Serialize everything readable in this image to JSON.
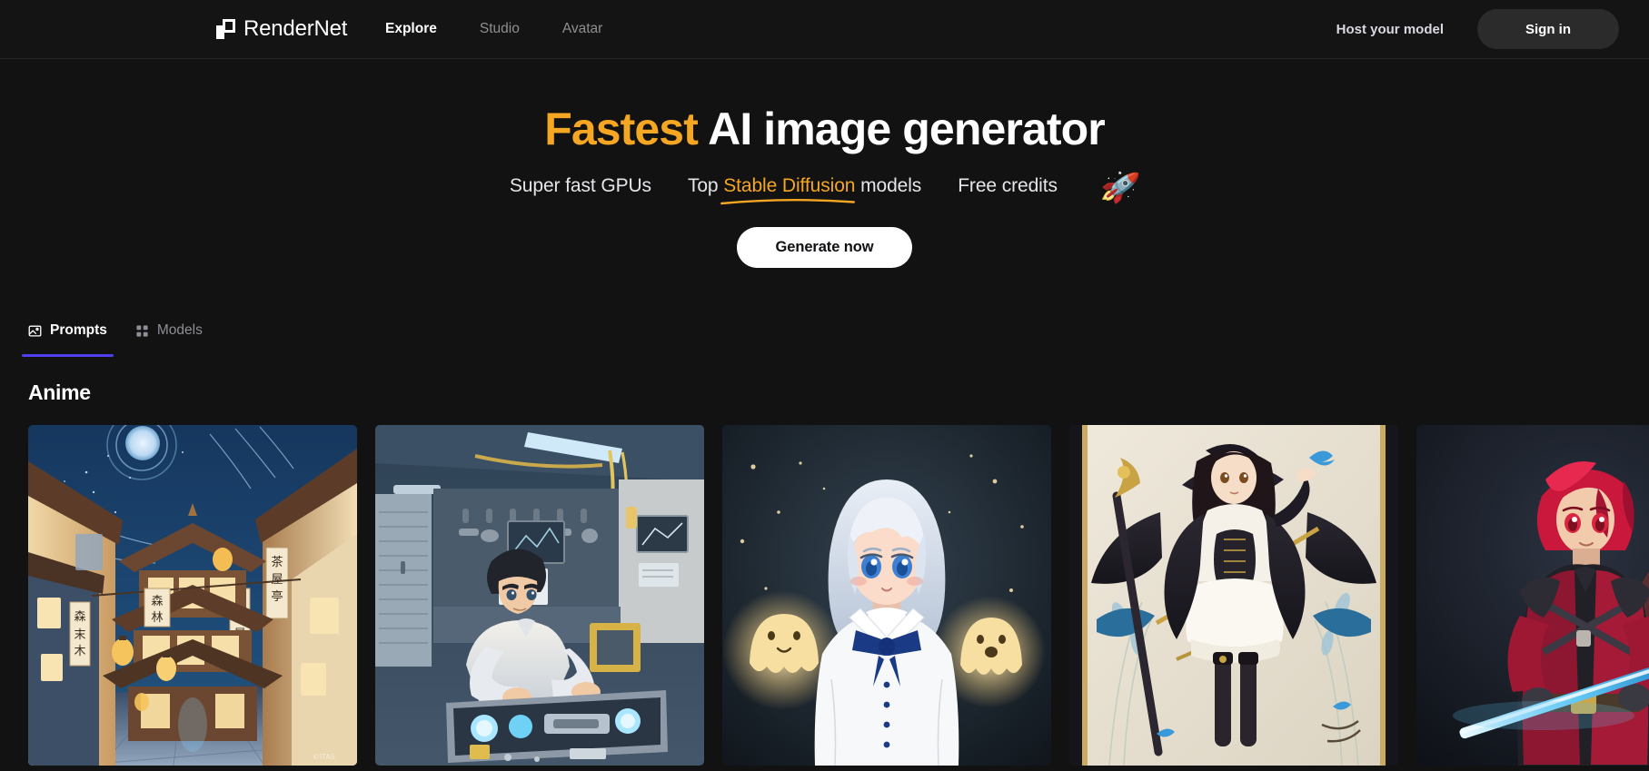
{
  "header": {
    "brand": "RenderNet",
    "brand_icon": "rendernet-logo-icon",
    "nav": [
      {
        "label": "Explore",
        "active": true
      },
      {
        "label": "Studio",
        "active": false
      },
      {
        "label": "Avatar",
        "active": false
      }
    ],
    "host_link": "Host your model",
    "signin_label": "Sign in"
  },
  "hero": {
    "title_accent": "Fastest",
    "title_rest": " AI image generator",
    "sub_1": "Super fast GPUs",
    "sub_2_pre": "Top ",
    "sub_2_accent": "Stable Diffusion",
    "sub_2_post": " models",
    "sub_3": "Free credits",
    "rocket_icon": "🚀",
    "cta_label": "Generate now"
  },
  "tabs": [
    {
      "label": "Prompts",
      "icon": "image-icon",
      "active": true
    },
    {
      "label": "Models",
      "icon": "grid-icon",
      "active": false
    }
  ],
  "section": {
    "title": "Anime"
  },
  "gallery": [
    {
      "alt": "anime night street with lanterns and pagoda",
      "watermark": "©ITAS"
    },
    {
      "alt": "anime boy repairing machine in workshop",
      "watermark": ""
    },
    {
      "alt": "anime girl with white hair and blue bow with ghosts",
      "watermark": ""
    },
    {
      "alt": "anime witch girl with staff and butterflies",
      "watermark": ""
    },
    {
      "alt": "anime red haired swordsman with glowing blade",
      "watermark": ""
    }
  ],
  "colors": {
    "page_bg": "#121212",
    "header_bg": "#141414",
    "accent_orange": "#f5a623",
    "accent_purple": "#4f3ff0",
    "text_primary": "#ffffff",
    "text_muted": "#8e8e95"
  }
}
